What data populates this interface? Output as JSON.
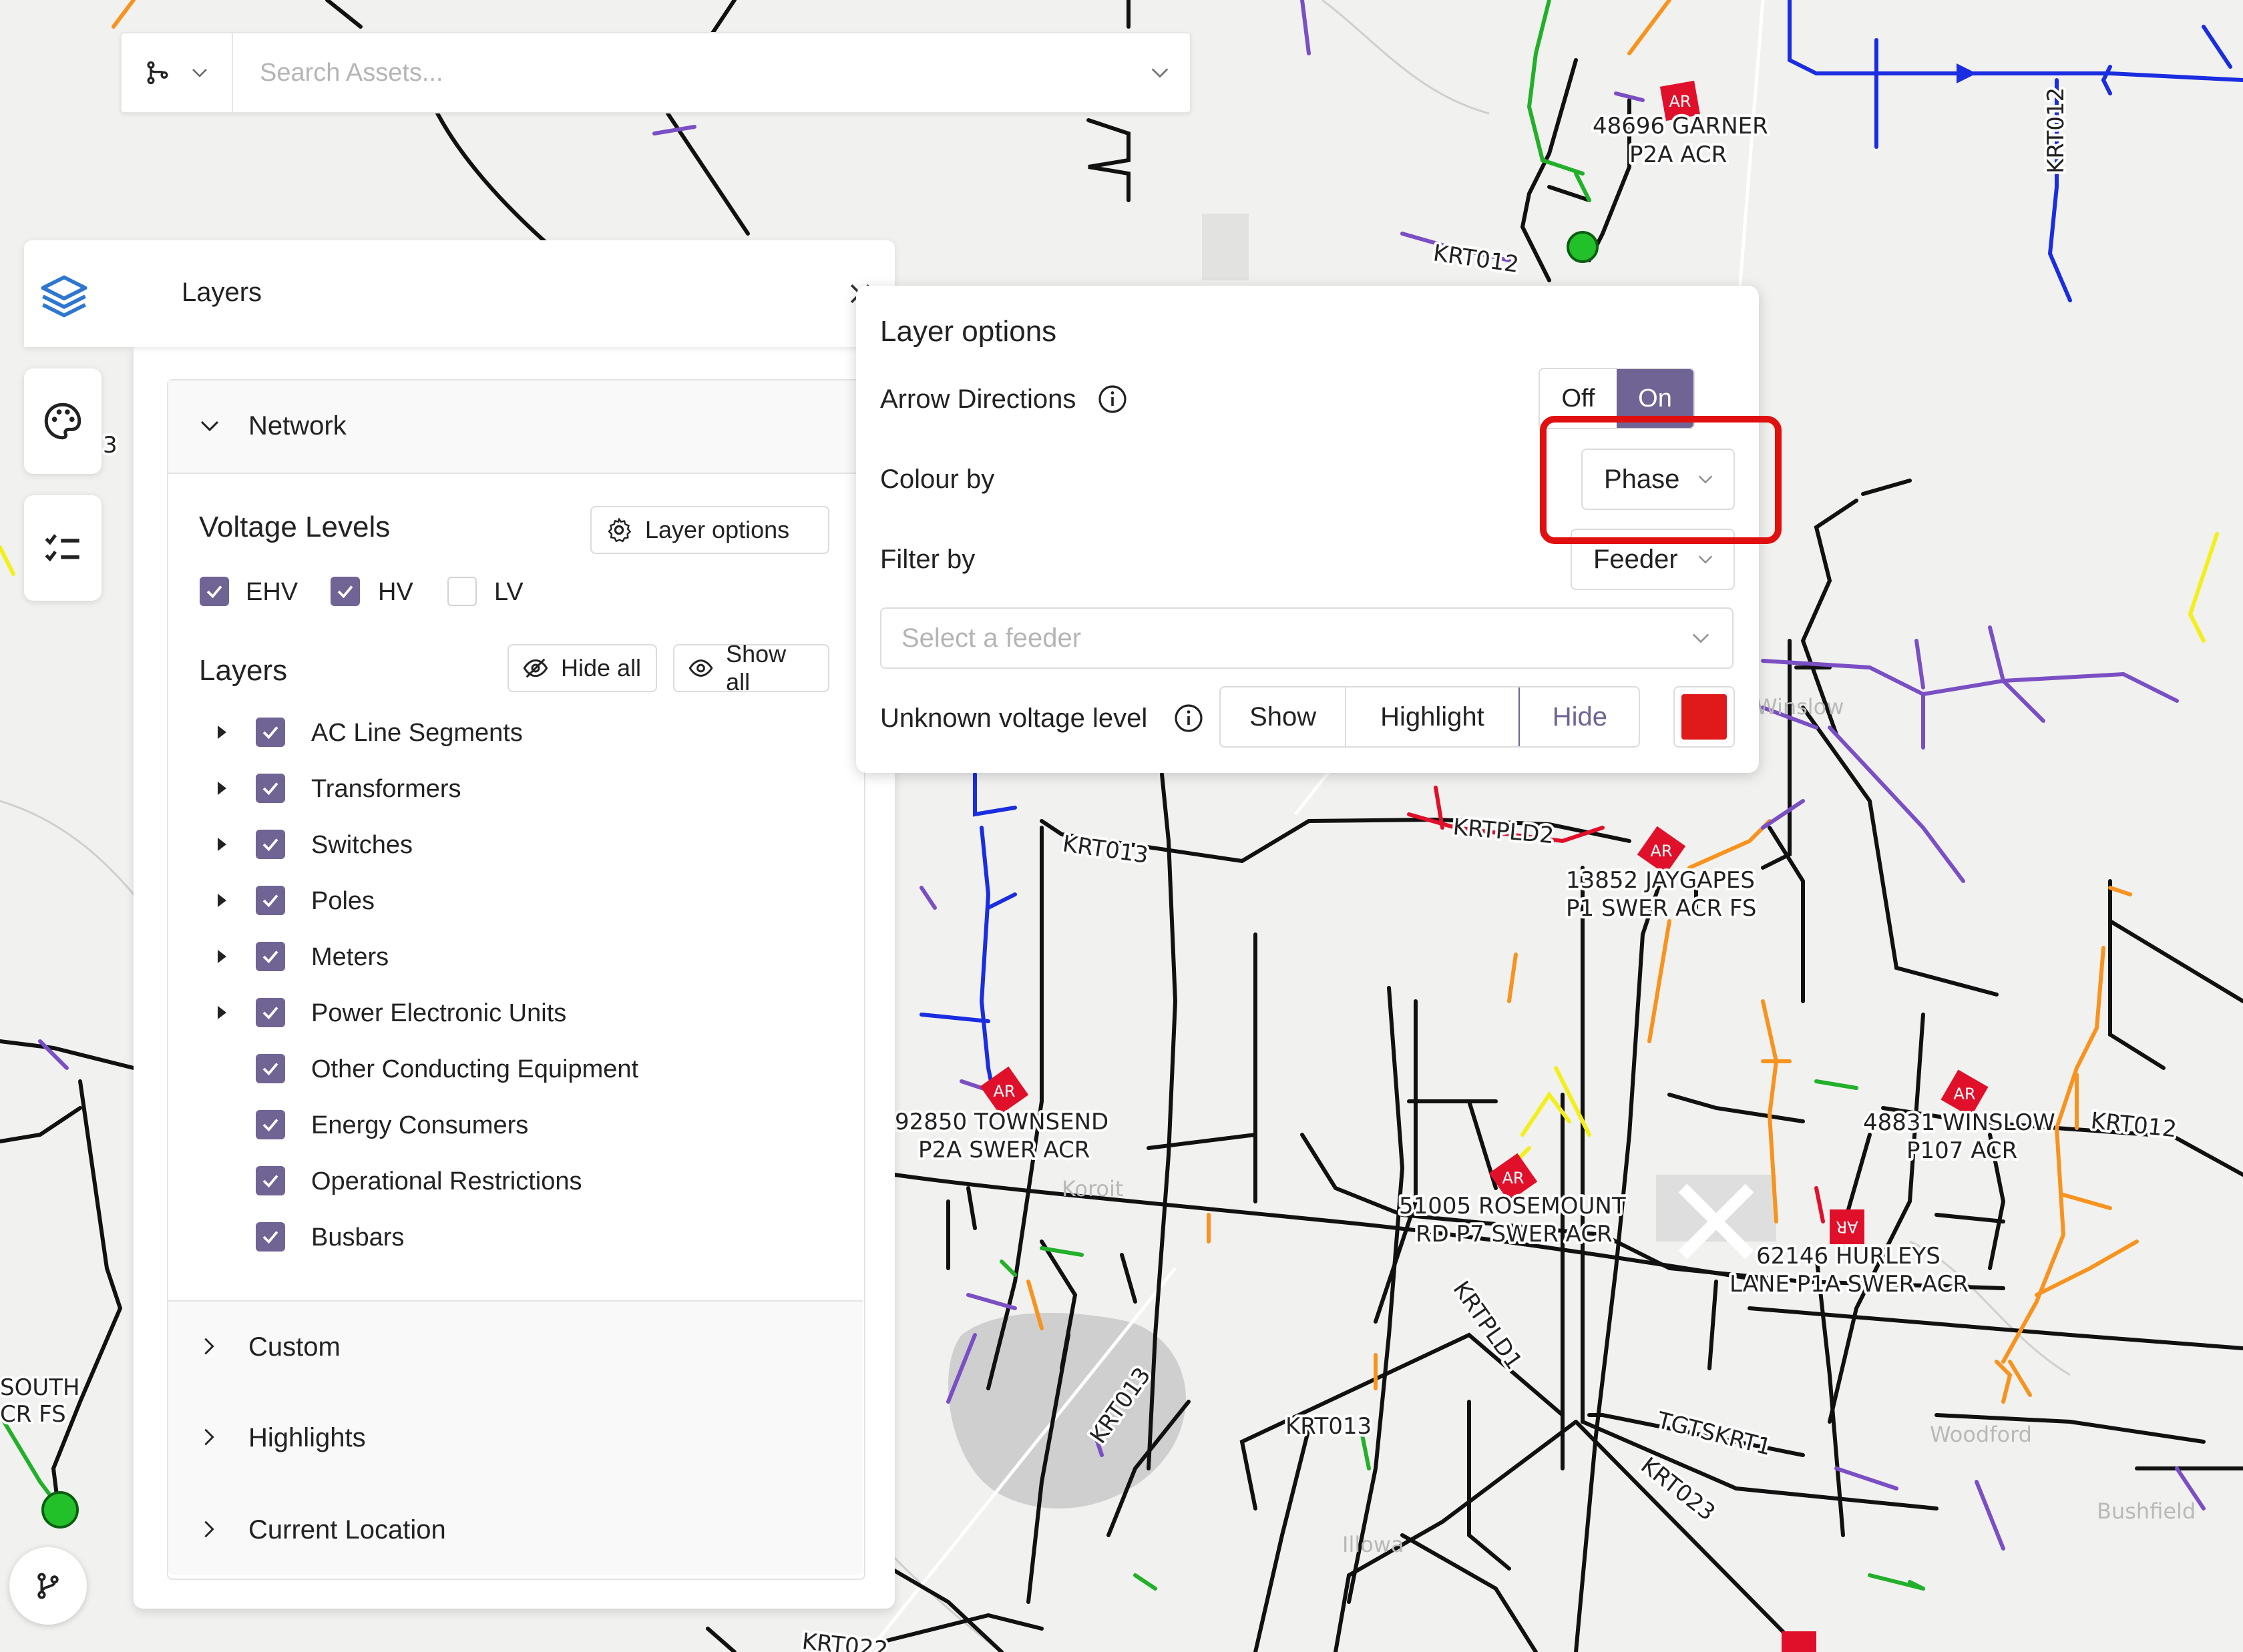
{
  "colors": {
    "accent": "#6f6494",
    "unknown_voltage_swatch": "#e01a1a",
    "highlight_box": "#e01010",
    "line_black": "#111111",
    "line_blue": "#1a2de0",
    "line_orange": "#f7931e",
    "line_purple": "#7b4fc4",
    "line_green": "#22b02a",
    "line_yellow": "#f3ef1c",
    "line_red": "#e0102a"
  },
  "search": {
    "mode_icon": "branch-icon",
    "placeholder": "Search Assets..."
  },
  "rail": {
    "layers_icon": "layers-icon",
    "palette_icon": "palette-icon",
    "checklist_icon": "checklist-icon",
    "bottom_icon": "branch-icon"
  },
  "layers_panel": {
    "title": "Layers",
    "network": {
      "header": "Network",
      "voltage_levels": {
        "title": "Voltage Levels",
        "layer_options_label": "Layer options",
        "items": [
          {
            "label": "EHV",
            "checked": true
          },
          {
            "label": "HV",
            "checked": true
          },
          {
            "label": "LV",
            "checked": false
          }
        ]
      },
      "layers": {
        "title": "Layers",
        "hide_all": "Hide all",
        "show_all": "Show all",
        "items": [
          {
            "label": "AC Line Segments",
            "checked": true,
            "expandable": true
          },
          {
            "label": "Transformers",
            "checked": true,
            "expandable": true
          },
          {
            "label": "Switches",
            "checked": true,
            "expandable": true
          },
          {
            "label": "Poles",
            "checked": true,
            "expandable": true
          },
          {
            "label": "Meters",
            "checked": true,
            "expandable": true
          },
          {
            "label": "Power Electronic Units",
            "checked": true,
            "expandable": true
          },
          {
            "label": "Other Conducting Equipment",
            "checked": true,
            "expandable": false
          },
          {
            "label": "Energy Consumers",
            "checked": true,
            "expandable": false
          },
          {
            "label": "Operational Restrictions",
            "checked": true,
            "expandable": false
          },
          {
            "label": "Busbars",
            "checked": true,
            "expandable": false
          }
        ]
      }
    },
    "sections": [
      "Custom",
      "Highlights",
      "Current Location"
    ]
  },
  "layer_options": {
    "title": "Layer options",
    "arrow_directions": {
      "label": "Arrow Directions",
      "off": "Off",
      "on": "On",
      "selected": "On"
    },
    "colour_by": {
      "label": "Colour by",
      "value": "Phase"
    },
    "filter_by": {
      "label": "Filter by",
      "value": "Feeder"
    },
    "feeder_placeholder": "Select a feeder",
    "unknown_voltage": {
      "label": "Unknown voltage level",
      "options": [
        "Show",
        "Highlight",
        "Hide"
      ],
      "selected": "Hide"
    }
  },
  "map": {
    "labels": {
      "garner": "48696 GARNER",
      "garner2": "P2A ACR",
      "krt012_top": "KRT012",
      "krt012_right": "KRT012",
      "krt013_a": "KRT013",
      "krtpld2": "KRTPLD2",
      "jaygapes": "13852 JAYGAPES",
      "jaygapes2": "P1 SWER ACR FS",
      "townsend": "92850 TOWNSEND",
      "townsend2": "P2A SWER ACR",
      "rosemount": "51005 ROSEMOUNT",
      "rosemount2": "RD P7 SWER ACR",
      "winslow": "48831 WINSLOW",
      "winslow2": "P107 ACR",
      "krt012_mid": "KRT012",
      "hurleys": "62146 HURLEYS",
      "hurleys2": "LANE P1A SWER ACR",
      "krtpld1": "KRTPLD1",
      "krt013_b": "KRT013",
      "krt013_c": "KRT013",
      "tgtskrt1": "TGTSKRT1",
      "krt023": "KRT023",
      "krt022": "KRT022",
      "south": "SOUTH",
      "south2": "CR FS",
      "left_3": "3",
      "ar": "AR"
    },
    "places": {
      "woodford": "Woodford",
      "bushfield": "Bushfield",
      "koroit": "Koroit",
      "killarney": "Illowa",
      "winslow": "Winslow"
    }
  }
}
